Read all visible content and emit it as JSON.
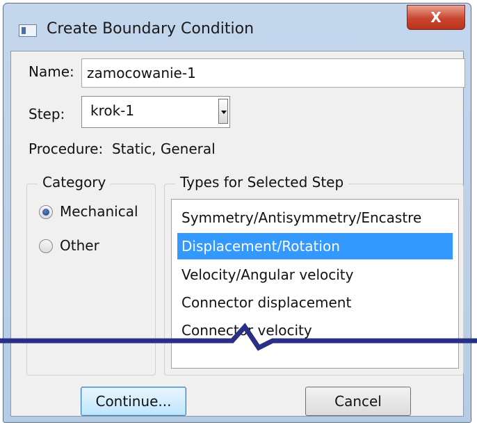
{
  "window": {
    "title": "Create Boundary Condition",
    "close_label": "X"
  },
  "form": {
    "name_label": "Name:",
    "name_value": "zamocowanie-1",
    "step_label": "Step:",
    "step_value": "krok-1",
    "procedure_label": "Procedure:",
    "procedure_value": "Static, General"
  },
  "category": {
    "title": "Category",
    "options": [
      {
        "label": "Mechanical",
        "checked": true
      },
      {
        "label": "Other",
        "checked": false
      }
    ]
  },
  "types": {
    "title": "Types for Selected Step",
    "items": [
      {
        "label": "Symmetry/Antisymmetry/Encastre",
        "selected": false
      },
      {
        "label": "Displacement/Rotation",
        "selected": true
      },
      {
        "label": "Velocity/Angular velocity",
        "selected": false
      },
      {
        "label": "Connector displacement",
        "selected": false
      },
      {
        "label": "Connector velocity",
        "selected": false
      }
    ]
  },
  "buttons": {
    "continue": "Continue...",
    "cancel": "Cancel"
  },
  "colors": {
    "selection": "#3399ff",
    "break_line": "#2a2f86"
  }
}
